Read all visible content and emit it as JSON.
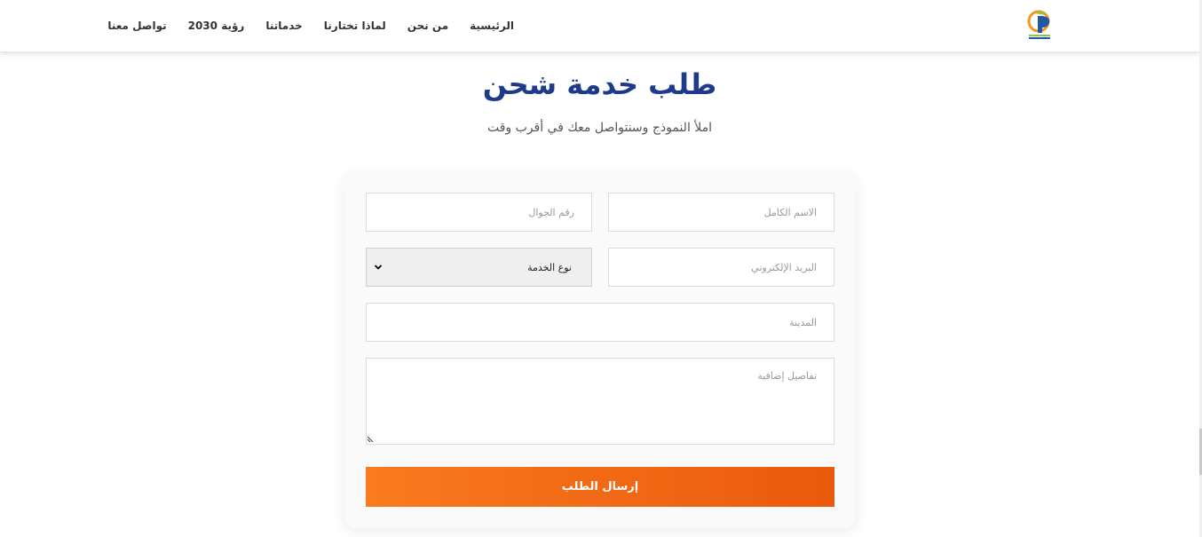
{
  "nav": {
    "items": [
      {
        "label": "الرئيسية"
      },
      {
        "label": "من نحن"
      },
      {
        "label": "لماذا تختارنا"
      },
      {
        "label": "خدماتنا"
      },
      {
        "label": "رؤية 2030"
      },
      {
        "label": "تواصل معنا"
      }
    ]
  },
  "logo": {
    "icon": "cp-logo-icon"
  },
  "page": {
    "title": "طلب خدمة شحن",
    "subtitle": "املأ النموذج وسنتواصل معك في أقرب وقت"
  },
  "form": {
    "full_name_placeholder": "الاسم الكامل",
    "mobile_placeholder": "رقم الجوال",
    "email_placeholder": "البريد الإلكتروني",
    "service_type_selected": "نوع الخدمة",
    "city_placeholder": "المدينة",
    "details_placeholder": "تفاصيل إضافية",
    "submit_label": "إرسال الطلب"
  },
  "colors": {
    "title": "#1e3a8a",
    "button_start": "#f97a1f",
    "button_end": "#ea5a0c"
  }
}
